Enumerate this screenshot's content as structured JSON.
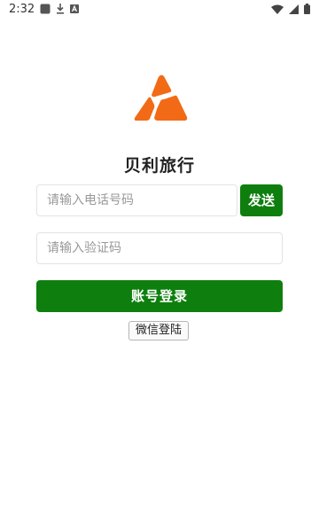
{
  "status_bar": {
    "time": "2:32",
    "icons": [
      "app-notification-icon",
      "download-icon",
      "font-a-icon",
      "wifi-icon",
      "cellular-signal-icon",
      "battery-icon"
    ]
  },
  "logo": {
    "icon": "triangle-logo-icon",
    "color": "#f26a16"
  },
  "app_name": "贝利旅行",
  "phone_field": {
    "placeholder": "请输入电话号码",
    "value": ""
  },
  "send_button": {
    "label": "发送"
  },
  "code_field": {
    "placeholder": "请输入验证码",
    "value": ""
  },
  "login_button": {
    "label": "账号登录"
  },
  "wechat_button": {
    "label": "微信登陆"
  },
  "colors": {
    "primary": "#0e7f0e",
    "accent": "#f26a16",
    "border": "#e3e3e3"
  }
}
